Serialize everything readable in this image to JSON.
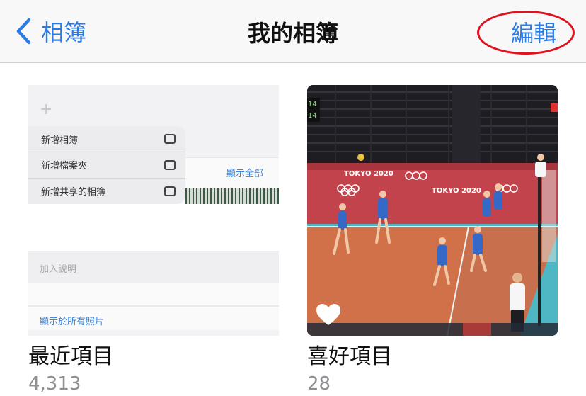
{
  "nav": {
    "back_label": "相簿",
    "title": "我的相簿",
    "edit_label": "編輯"
  },
  "albums": [
    {
      "name": "最近項目",
      "count": "4,313",
      "thumbnail": {
        "menu_items": [
          "新增相簿",
          "新增檔案夾",
          "新增共享的相簿"
        ],
        "show_all": "顯示全部",
        "caption_placeholder": "加入說明",
        "show_in_all_photos": "顯示於所有照片"
      }
    },
    {
      "name": "喜好項目",
      "count": "28",
      "thumbnail": {
        "venue_text": "TOKYO 2020",
        "score_digits": [
          "14",
          "14"
        ]
      }
    }
  ],
  "colors": {
    "accent": "#2c7be5",
    "highlight_ring": "#e3101e",
    "court_orange": "#d1714a",
    "court_blue": "#4fb6c3",
    "wall_red": "#c2434b"
  }
}
